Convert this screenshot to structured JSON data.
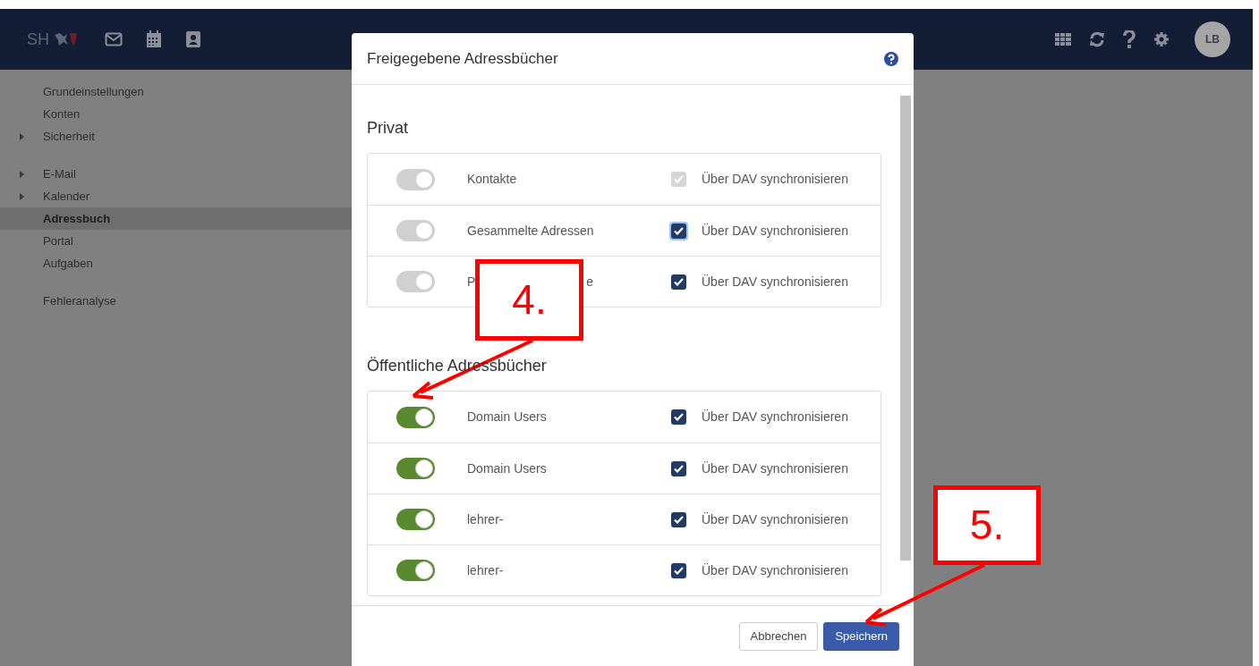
{
  "header": {
    "logo": "SH",
    "avatar": "LB"
  },
  "sidebar": {
    "groups": [
      {
        "items": [
          {
            "label": "Grundeinstellungen",
            "arrow": false,
            "selected": false
          },
          {
            "label": "Konten",
            "arrow": false,
            "selected": false
          },
          {
            "label": "Sicherheit",
            "arrow": true,
            "selected": false
          }
        ]
      },
      {
        "items": [
          {
            "label": "E-Mail",
            "arrow": true,
            "selected": false
          },
          {
            "label": "Kalender",
            "arrow": true,
            "selected": false
          },
          {
            "label": "Adressbuch",
            "arrow": false,
            "selected": true
          },
          {
            "label": "Portal",
            "arrow": false,
            "selected": false
          },
          {
            "label": "Aufgaben",
            "arrow": false,
            "selected": false
          }
        ]
      },
      {
        "items": [
          {
            "label": "Fehleranalyse",
            "arrow": false,
            "selected": false
          }
        ]
      }
    ]
  },
  "dialog": {
    "title": "Freigegebene Adressbücher",
    "sections": [
      {
        "heading": "Privat",
        "rows": [
          {
            "label_parts": [
              "Kontakte"
            ],
            "on": true,
            "toggle_disabled": true,
            "checked": true,
            "check_disabled": true,
            "focused": false,
            "sync": "Über DAV synchronisieren"
          },
          {
            "label_parts": [
              "Gesammelte Adressen"
            ],
            "on": true,
            "toggle_disabled": true,
            "checked": true,
            "check_disabled": false,
            "focused": true,
            "sync": "Über DAV synchronisieren"
          },
          {
            "label_parts": [
              "P",
              "e"
            ],
            "on": true,
            "toggle_disabled": true,
            "checked": true,
            "check_disabled": false,
            "focused": false,
            "sync": "Über DAV synchronisieren"
          }
        ]
      },
      {
        "heading": "Öffentliche Adressbücher",
        "rows": [
          {
            "label_parts": [
              "Domain Users"
            ],
            "on": true,
            "toggle_disabled": false,
            "checked": true,
            "check_disabled": false,
            "focused": false,
            "sync": "Über DAV synchronisieren"
          },
          {
            "label_parts": [
              "Domain Users"
            ],
            "on": true,
            "toggle_disabled": false,
            "checked": true,
            "check_disabled": false,
            "focused": false,
            "sync": "Über DAV synchronisieren"
          },
          {
            "label_parts": [
              "lehrer-"
            ],
            "on": true,
            "toggle_disabled": false,
            "checked": true,
            "check_disabled": false,
            "focused": false,
            "sync": "Über DAV synchronisieren"
          },
          {
            "label_parts": [
              "lehrer-"
            ],
            "on": true,
            "toggle_disabled": false,
            "checked": true,
            "check_disabled": false,
            "focused": false,
            "sync": "Über DAV synchronisieren"
          }
        ]
      }
    ],
    "buttons": [
      {
        "label": "Abbrechen",
        "kind": "secondary"
      },
      {
        "label": "Speichern",
        "kind": "primary"
      }
    ]
  },
  "annotations": [
    {
      "label": "4."
    },
    {
      "label": "5."
    }
  ]
}
